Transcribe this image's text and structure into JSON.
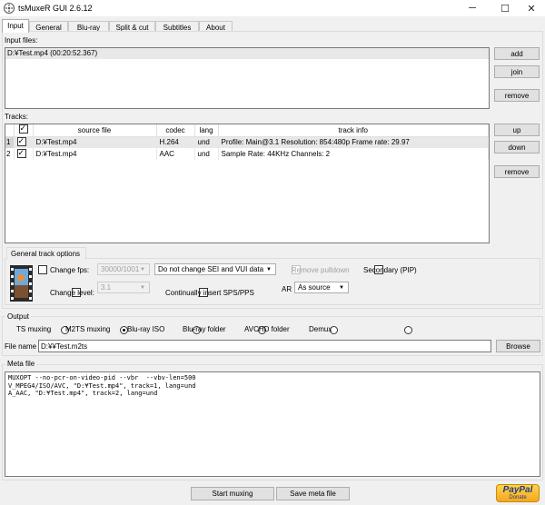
{
  "window": {
    "title": "tsMuxeR GUI 2.6.12",
    "minimize": "─",
    "maximize": "☐",
    "close": "✕"
  },
  "tabs": [
    {
      "label": "Input",
      "active": true
    },
    {
      "label": "General"
    },
    {
      "label": "Blu-ray"
    },
    {
      "label": "Split & cut"
    },
    {
      "label": "Subtitles"
    },
    {
      "label": "About"
    }
  ],
  "input_files": {
    "label": "Input files:",
    "items": [
      "D:¥Test.mp4 (00:20:52.367)"
    ],
    "add": "add",
    "join": "join",
    "remove": "remove"
  },
  "tracks": {
    "label": "Tracks:",
    "columns": [
      "",
      "source file",
      "codec",
      "lang",
      "track info"
    ],
    "rows": [
      {
        "num": "1",
        "checked": true,
        "source": "D:¥Test.mp4",
        "codec": "H.264",
        "lang": "und",
        "info": "Profile: Main@3.1  Resolution: 854:480p  Frame rate: 29.97"
      },
      {
        "num": "2",
        "checked": true,
        "source": "D:¥Test.mp4",
        "codec": "AAC",
        "lang": "und",
        "info": "Sample Rate: 44KHz  Channels: 2"
      }
    ],
    "up": "up",
    "down": "down",
    "remove": "remove"
  },
  "general_track_options": {
    "title": "General track options",
    "change_fps": "Change fps:",
    "fps_value": "30000/1001",
    "sei_value": "Do not change SEI and VUI data",
    "remove_pulldown": "Remove pulldown",
    "secondary": "Secondary (PIP)",
    "change_level": "Change level:",
    "level_value": "3.1",
    "continually_insert": "Continually insert SPS/PPS",
    "ar_label": "AR",
    "ar_value": "As source"
  },
  "output": {
    "label": "Output",
    "options": [
      {
        "label": "TS muxing",
        "selected": false
      },
      {
        "label": "M2TS muxing",
        "selected": true
      },
      {
        "label": "Blu-ray ISO",
        "selected": false
      },
      {
        "label": "Blu-ray folder",
        "selected": false
      },
      {
        "label": "AVCHD folder",
        "selected": false
      },
      {
        "label": "Demux",
        "selected": false
      }
    ],
    "file_name_label": "File name",
    "file_name_value": "D:¥¥Test.m2ts",
    "browse": "Browse"
  },
  "meta_file": {
    "label": "Meta file",
    "content": "MUXOPT --no-pcr-on-video-pid --vbr  --vbv-len=500\nV_MPEG4/ISO/AVC, \"D:¥Test.mp4\", track=1, lang=und\nA_AAC, \"D:¥Test.mp4\", track=2, lang=und"
  },
  "footer": {
    "start_muxing": "Start muxing",
    "save_meta": "Save meta file",
    "paypal": "PayPal",
    "donate": "Donate"
  },
  "colors": {
    "window_bg": "#f0f0f0",
    "list_bg": "#ffffff",
    "selection": "#e8e8e8",
    "paypal_gold": "#ffc439",
    "paypal_blue": "#253b80"
  },
  "icons": {
    "app": "film-reel-icon",
    "options": "film-strip-icon"
  }
}
